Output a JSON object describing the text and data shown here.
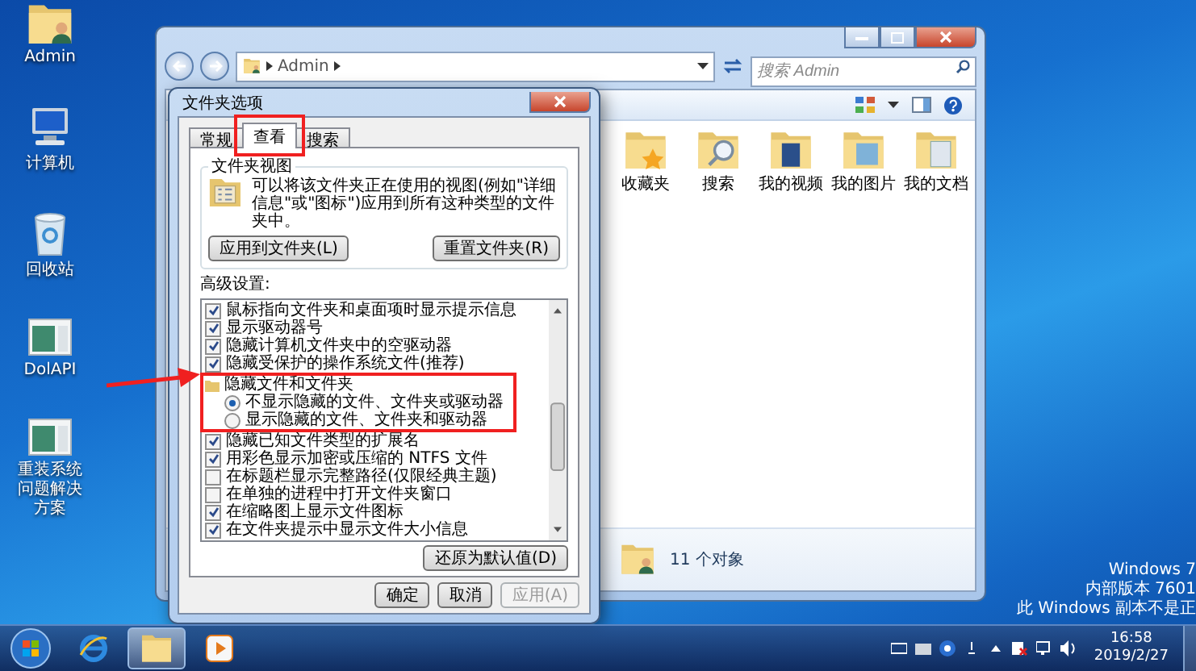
{
  "desktop_icons": [
    {
      "label": "Admin"
    },
    {
      "label": "计算机"
    },
    {
      "label": "回收站"
    },
    {
      "label": "DolAPI"
    },
    {
      "label": "重装系统问题解决方案"
    }
  ],
  "explorer": {
    "address": "Admin",
    "search": {
      "placeholder": "搜索 Admin"
    },
    "items": [
      {
        "label": "收藏夹"
      },
      {
        "label": "搜索"
      },
      {
        "label": "我的视频"
      },
      {
        "label": "我的图片"
      },
      {
        "label": "我的文档"
      }
    ],
    "status": "11 个对象"
  },
  "dialog": {
    "title": "文件夹选项",
    "tabs": [
      {
        "label": "常规",
        "selected": false
      },
      {
        "label": "查看",
        "selected": true
      },
      {
        "label": "搜索",
        "selected": false
      }
    ],
    "folder_views": {
      "title": "文件夹视图",
      "description": "可以将该文件夹正在使用的视图(例如\"详细信息\"或\"图标\")应用到所有这种类型的文件夹中。",
      "buttons": [
        "应用到文件夹(L)",
        "重置文件夹(R)"
      ]
    },
    "advanced": {
      "title": "高级设置:",
      "items": [
        {
          "kind": "checkbox",
          "label": "鼠标指向文件夹和桌面项时显示提示信息",
          "checked": true
        },
        {
          "kind": "checkbox",
          "label": "显示驱动器号",
          "checked": true
        },
        {
          "kind": "checkbox",
          "label": "隐藏计算机文件夹中的空驱动器",
          "checked": true
        },
        {
          "kind": "checkbox",
          "label": "隐藏受保护的操作系统文件(推荐)",
          "checked": true
        },
        {
          "kind": "group",
          "label": "隐藏文件和文件夹",
          "children": [
            {
              "kind": "radio",
              "label": "不显示隐藏的文件、文件夹或驱动器",
              "selected": true
            },
            {
              "kind": "radio",
              "label": "显示隐藏的文件、文件夹和驱动器",
              "selected": false
            }
          ]
        },
        {
          "kind": "checkbox",
          "label": "隐藏已知文件类型的扩展名",
          "checked": true
        },
        {
          "kind": "checkbox",
          "label": "用彩色显示加密或压缩的 NTFS 文件",
          "checked": true
        },
        {
          "kind": "checkbox",
          "label": "在标题栏显示完整路径(仅限经典主题)",
          "checked": false
        },
        {
          "kind": "checkbox",
          "label": "在单独的进程中打开文件夹窗口",
          "checked": false
        },
        {
          "kind": "checkbox",
          "label": "在缩略图上显示文件图标",
          "checked": true
        },
        {
          "kind": "checkbox",
          "label": "在文件夹提示中显示文件大小信息",
          "checked": true
        }
      ],
      "restore_button": "还原为默认值(D)"
    },
    "buttons": [
      {
        "label": "确定",
        "disabled": false
      },
      {
        "label": "取消",
        "disabled": false
      },
      {
        "label": "应用(A)",
        "disabled": true
      }
    ]
  },
  "watermark": [
    "Windows 7",
    "内部版本 7601",
    "此 Windows 副本不是正"
  ],
  "taskbar": {
    "time": "16:58",
    "date": "2019/2/27"
  }
}
